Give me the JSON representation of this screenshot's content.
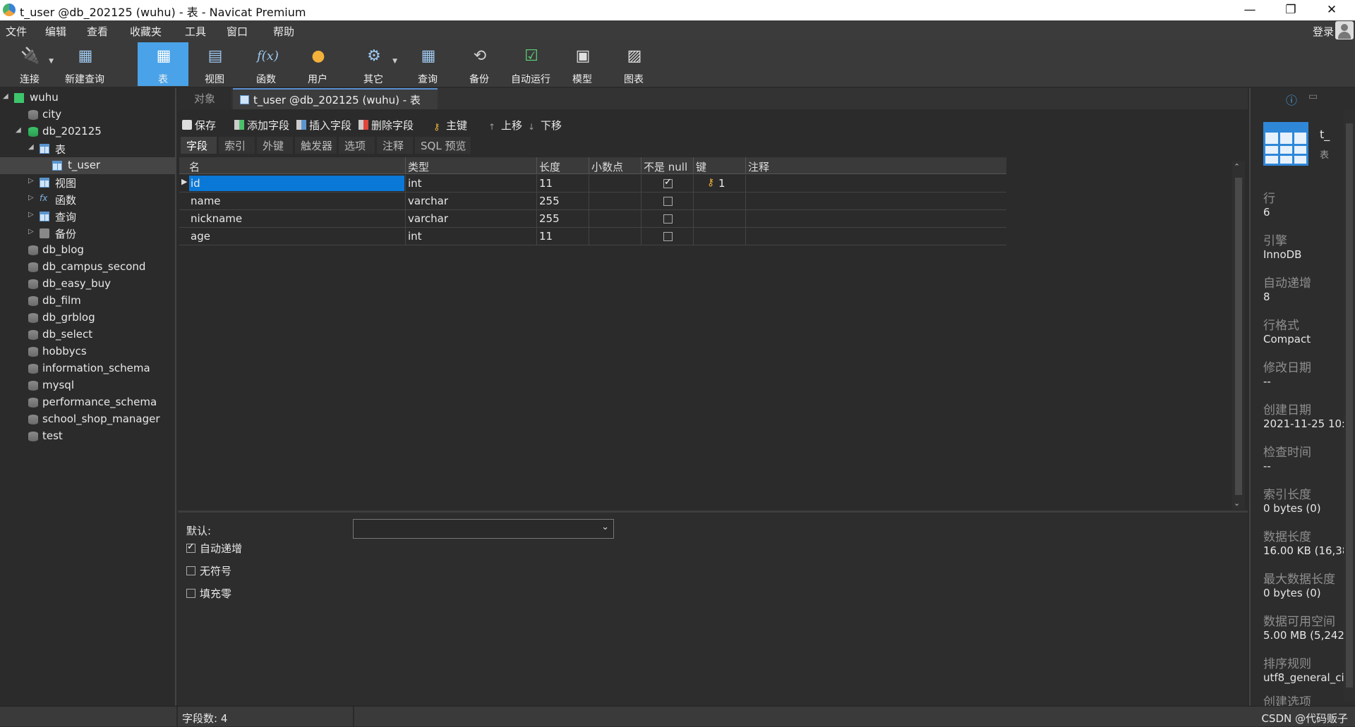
{
  "window": {
    "title": "t_user @db_202125 (wuhu) - 表 - Navicat Premium",
    "minimize": "—",
    "maximize": "❐",
    "close": "✕"
  },
  "menu": {
    "items": [
      "文件",
      "编辑",
      "查看",
      "收藏夹",
      "工具",
      "窗口",
      "帮助"
    ],
    "login": "登录"
  },
  "toolbar": {
    "items": [
      {
        "label": "连接",
        "icon": "connect-icon"
      },
      {
        "label": "新建查询",
        "icon": "new-query-icon"
      },
      {
        "label": "表",
        "icon": "table-icon",
        "active": true
      },
      {
        "label": "视图",
        "icon": "view-icon"
      },
      {
        "label": "函数",
        "icon": "function-icon"
      },
      {
        "label": "用户",
        "icon": "user-icon"
      },
      {
        "label": "其它",
        "icon": "other-icon"
      },
      {
        "label": "查询",
        "icon": "query-icon"
      },
      {
        "label": "备份",
        "icon": "backup-icon"
      },
      {
        "label": "自动运行",
        "icon": "automation-icon"
      },
      {
        "label": "模型",
        "icon": "model-icon"
      },
      {
        "label": "图表",
        "icon": "chart-icon"
      }
    ]
  },
  "sidebar": {
    "connection": "wuhu",
    "databases_before": [
      "city"
    ],
    "open_db": "db_202125",
    "tables_group": "表",
    "open_table": "t_user",
    "groups": [
      "视图",
      "函数",
      "查询",
      "备份"
    ],
    "databases_after": [
      "db_blog",
      "db_campus_second",
      "db_easy_buy",
      "db_film",
      "db_grblog",
      "db_select",
      "hobbycs",
      "information_schema",
      "mysql",
      "performance_schema",
      "school_shop_manager",
      "test"
    ]
  },
  "tabs": {
    "objects": "对象",
    "active": "t_user @db_202125 (wuhu) - 表"
  },
  "editor_toolbar": {
    "save": "保存",
    "add_field": "添加字段",
    "insert_field": "插入字段",
    "delete_field": "删除字段",
    "primary_key": "主键",
    "move_up": "上移",
    "move_down": "下移"
  },
  "subtabs": [
    "字段",
    "索引",
    "外键",
    "触发器",
    "选项",
    "注释",
    "SQL 预览"
  ],
  "grid": {
    "headers": [
      "名",
      "类型",
      "长度",
      "小数点",
      "不是 null",
      "键",
      "注释"
    ],
    "rows": [
      {
        "name": "id",
        "type": "int",
        "length": "11",
        "decimals": "",
        "not_null": true,
        "key": "1",
        "comment": ""
      },
      {
        "name": "name",
        "type": "varchar",
        "length": "255",
        "decimals": "",
        "not_null": false,
        "key": "",
        "comment": ""
      },
      {
        "name": "nickname",
        "type": "varchar",
        "length": "255",
        "decimals": "",
        "not_null": false,
        "key": "",
        "comment": ""
      },
      {
        "name": "age",
        "type": "int",
        "length": "11",
        "decimals": "",
        "not_null": false,
        "key": "",
        "comment": ""
      }
    ]
  },
  "bottom": {
    "default_label": "默认:",
    "default_value": "",
    "auto_increment": "自动递增",
    "unsigned": "无符号",
    "zerofill": "填充零"
  },
  "info": {
    "name": "t_",
    "type": "表",
    "fields": [
      {
        "label": "行",
        "value": "6"
      },
      {
        "label": "引擎",
        "value": "InnoDB"
      },
      {
        "label": "自动递增",
        "value": "8"
      },
      {
        "label": "行格式",
        "value": "Compact"
      },
      {
        "label": "修改日期",
        "value": "--"
      },
      {
        "label": "创建日期",
        "value": "2021-11-25 10:"
      },
      {
        "label": "检查时间",
        "value": "--"
      },
      {
        "label": "索引长度",
        "value": "0 bytes (0)"
      },
      {
        "label": "数据长度",
        "value": "16.00 KB (16,38"
      },
      {
        "label": "最大数据长度",
        "value": "0 bytes (0)"
      },
      {
        "label": "数据可用空间",
        "value": "5.00 MB (5,242,"
      },
      {
        "label": "排序规则",
        "value": "utf8_general_ci"
      },
      {
        "label": "创建选项",
        "value": ""
      }
    ]
  },
  "status": {
    "field_count": "字段数: 4",
    "watermark": "CSDN @代码贩子"
  }
}
